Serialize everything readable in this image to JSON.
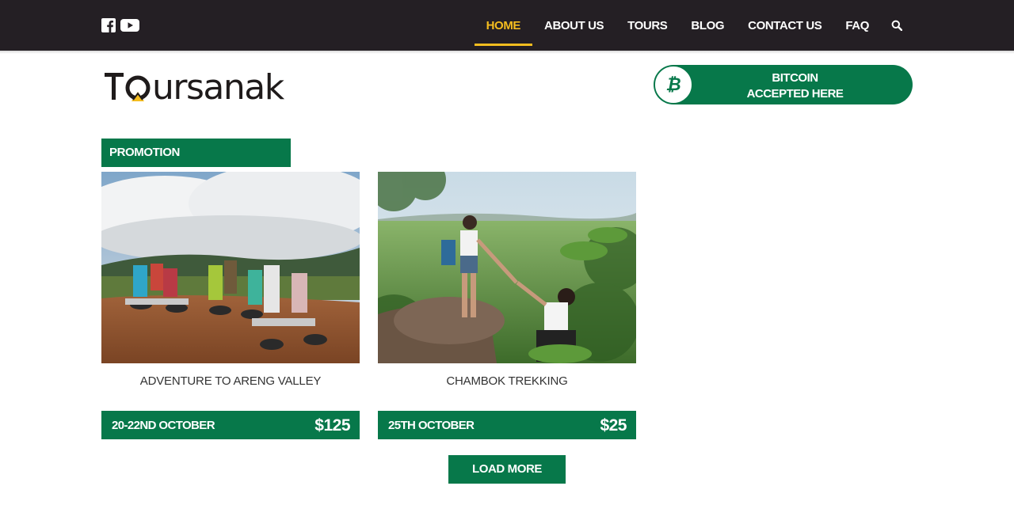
{
  "topbar": {
    "social": [
      {
        "icon": "facebook-icon"
      },
      {
        "icon": "youtube-icon"
      }
    ],
    "nav": [
      {
        "label": "HOME",
        "active": true
      },
      {
        "label": "ABOUT US"
      },
      {
        "label": "TOURS"
      },
      {
        "label": "BLOG"
      },
      {
        "label": "CONTACT US"
      },
      {
        "label": "FAQ"
      }
    ],
    "search_icon": "search-icon"
  },
  "logo": {
    "text": "Toursanak"
  },
  "bitcoin_badge": {
    "symbol": "₿",
    "line1": "BITCOIN",
    "line2": "ACCEPTED HERE"
  },
  "promotion": {
    "heading": "PROMOTION",
    "cards": [
      {
        "title": "ADVENTURE TO ARENG VALLEY",
        "date": "20-22ND OCTOBER",
        "price": "$125"
      },
      {
        "title": "CHAMBOK TREKKING",
        "date": "25TH OCTOBER",
        "price": "$25"
      }
    ],
    "load_more": "LOAD MORE"
  },
  "colors": {
    "brand_green": "#07784a",
    "topbar_bg": "#241f24",
    "nav_active": "#f5bd1f"
  }
}
